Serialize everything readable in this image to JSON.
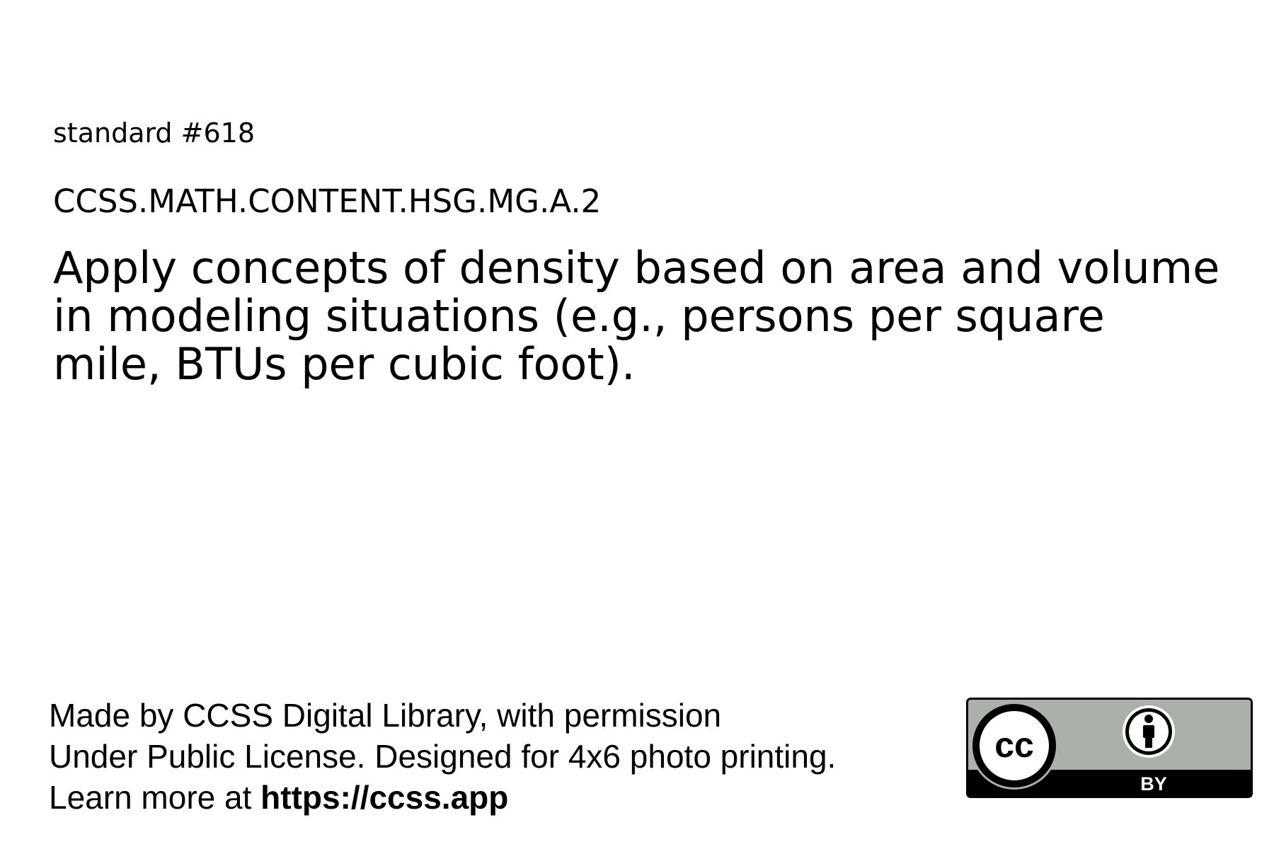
{
  "card": {
    "standard_number": "standard #618",
    "standard_code": "CCSS.MATH.CONTENT.HSG.MG.A.2",
    "standard_text_lines": [
      "Apply concepts of density based on area and volume",
      "in modeling situations (e.g., persons per square",
      "mile, BTUs per cubic foot)."
    ]
  },
  "footer": {
    "line1": "Made by CCSS Digital Library, with permission",
    "line2": "Under Public License. Designed for 4x6 photo printing.",
    "line3_prefix": "Learn more at ",
    "line3_url": "https://ccss.app"
  },
  "license_badge": {
    "icon": "cc-by-icon",
    "cc_text": "cc",
    "by_text": "BY",
    "colors": {
      "badge_bg": "#abb1aa",
      "badge_border": "#000000",
      "bottom_band": "#000000"
    }
  }
}
